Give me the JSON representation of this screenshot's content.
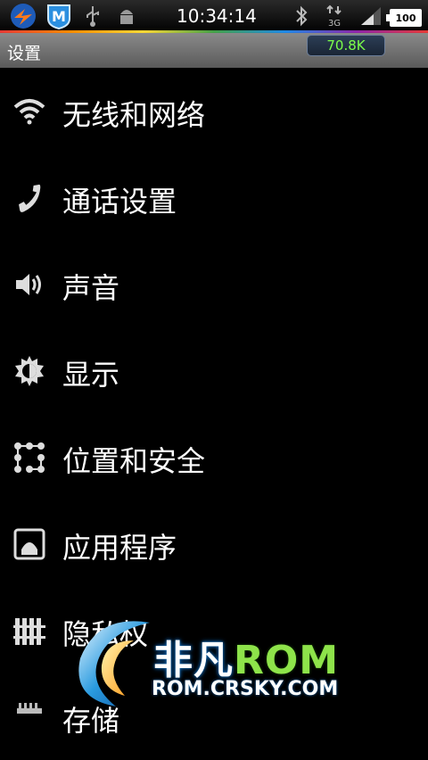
{
  "status_bar": {
    "time": "10:34:14",
    "battery": "100",
    "network": "3G",
    "icons": [
      "app-orange-icon",
      "security-m-icon",
      "usb-icon",
      "android-debug-icon",
      "bluetooth-icon",
      "3g-data-icon",
      "signal-icon",
      "battery-icon"
    ]
  },
  "title_bar": {
    "title": "设置",
    "speed": "70.8K"
  },
  "settings": {
    "items": [
      {
        "label": "无线和网络",
        "icon": "wifi-icon"
      },
      {
        "label": "通话设置",
        "icon": "phone-icon"
      },
      {
        "label": "声音",
        "icon": "speaker-icon"
      },
      {
        "label": "显示",
        "icon": "brightness-icon"
      },
      {
        "label": "位置和安全",
        "icon": "location-grid-icon"
      },
      {
        "label": "应用程序",
        "icon": "apps-icon"
      },
      {
        "label": "隐私权",
        "icon": "privacy-fence-icon"
      },
      {
        "label": "存储",
        "icon": "storage-icon"
      }
    ]
  },
  "watermark": {
    "brand_a": "非凡",
    "brand_b": "ROM",
    "url": "ROM.CRSKY.COM"
  }
}
